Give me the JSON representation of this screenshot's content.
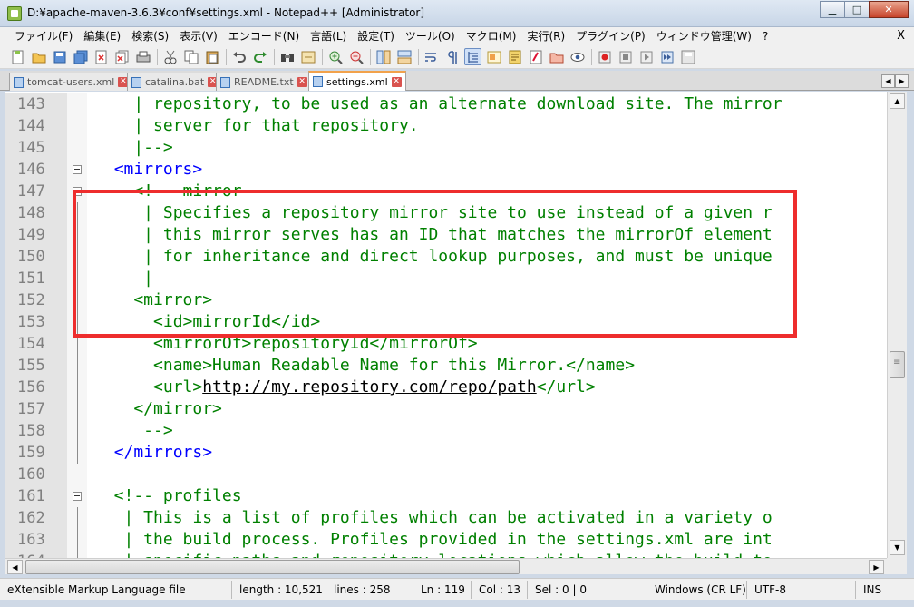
{
  "window": {
    "title": "D:¥apache-maven-3.6.3¥conf¥settings.xml - Notepad++ [Administrator]",
    "minimize": "▁",
    "maximize": "□",
    "close": "✕"
  },
  "menu": {
    "items": [
      "ファイル(F)",
      "編集(E)",
      "検索(S)",
      "表示(V)",
      "エンコード(N)",
      "言語(L)",
      "設定(T)",
      "ツール(O)",
      "マクロ(M)",
      "実行(R)",
      "プラグイン(P)",
      "ウィンドウ管理(W)",
      "?"
    ],
    "doc_close": "X"
  },
  "tabs": [
    {
      "label": "tomcat-users.xml",
      "close": "✕"
    },
    {
      "label": "catalina.bat",
      "close": "✕"
    },
    {
      "label": "README.txt",
      "close": "✕"
    },
    {
      "label": "settings.xml",
      "close": "✕"
    }
  ],
  "tab_scroll": {
    "left": "◀",
    "right": "▶"
  },
  "scroll": {
    "up": "▲",
    "down": "▼",
    "left": "◀",
    "right": "▶",
    "grip": "≡"
  },
  "colors": {
    "highlight": "#ee2d2d",
    "tag": "#0000ff",
    "comment": "#008000",
    "active_tab_accent": "#f2a24b"
  },
  "editor": {
    "lines": [
      {
        "n": "143",
        "fold": "none",
        "segments": [
          {
            "t": "    | repository, to be used as an alternate download site. The mirror",
            "c": "com"
          }
        ]
      },
      {
        "n": "144",
        "fold": "none",
        "segments": [
          {
            "t": "    | server for that repository.",
            "c": "com"
          }
        ]
      },
      {
        "n": "145",
        "fold": "none",
        "segments": [
          {
            "t": "    |-->",
            "c": "com"
          }
        ]
      },
      {
        "n": "146",
        "fold": "box",
        "segments": [
          {
            "t": "  ",
            "c": "txt"
          },
          {
            "t": "<mirrors>",
            "c": "tag"
          }
        ]
      },
      {
        "n": "147",
        "fold": "box",
        "segments": [
          {
            "t": "    <!-- mirror",
            "c": "com"
          }
        ]
      },
      {
        "n": "148",
        "fold": "line",
        "segments": [
          {
            "t": "     | Specifies a repository mirror site to use instead of a given r",
            "c": "com"
          }
        ]
      },
      {
        "n": "149",
        "fold": "line",
        "segments": [
          {
            "t": "     | this mirror serves has an ID that matches the mirrorOf element",
            "c": "com"
          }
        ]
      },
      {
        "n": "150",
        "fold": "line",
        "segments": [
          {
            "t": "     | for inheritance and direct lookup purposes, and must be unique",
            "c": "com"
          }
        ]
      },
      {
        "n": "151",
        "fold": "line",
        "segments": [
          {
            "t": "     |",
            "c": "com"
          }
        ]
      },
      {
        "n": "152",
        "fold": "line",
        "segments": [
          {
            "t": "    <mirror>",
            "c": "com"
          }
        ]
      },
      {
        "n": "153",
        "fold": "line",
        "segments": [
          {
            "t": "      <id>mirrorId</id>",
            "c": "com"
          }
        ]
      },
      {
        "n": "154",
        "fold": "line",
        "segments": [
          {
            "t": "      <mirrorOf>repositoryId</mirrorOf>",
            "c": "com"
          }
        ]
      },
      {
        "n": "155",
        "fold": "line",
        "segments": [
          {
            "t": "      <name>Human Readable Name for this Mirror.</name>",
            "c": "com"
          }
        ]
      },
      {
        "n": "156",
        "fold": "line",
        "segments": [
          {
            "t": "      <url>",
            "c": "com"
          },
          {
            "t": "http://my.repository.com/repo/path",
            "c": "url"
          },
          {
            "t": "</url>",
            "c": "com"
          }
        ]
      },
      {
        "n": "157",
        "fold": "line",
        "segments": [
          {
            "t": "    </mirror>",
            "c": "com"
          }
        ]
      },
      {
        "n": "158",
        "fold": "line",
        "segments": [
          {
            "t": "     -->",
            "c": "com"
          }
        ]
      },
      {
        "n": "159",
        "fold": "line",
        "segments": [
          {
            "t": "  ",
            "c": "txt"
          },
          {
            "t": "</mirrors>",
            "c": "tag"
          }
        ]
      },
      {
        "n": "160",
        "fold": "none",
        "segments": [
          {
            "t": "",
            "c": "txt"
          }
        ]
      },
      {
        "n": "161",
        "fold": "box",
        "segments": [
          {
            "t": "  <!-- profiles",
            "c": "com"
          }
        ]
      },
      {
        "n": "162",
        "fold": "line",
        "segments": [
          {
            "t": "   | This is a list of profiles which can be activated in a variety o",
            "c": "com"
          }
        ]
      },
      {
        "n": "163",
        "fold": "line",
        "segments": [
          {
            "t": "   | the build process. Profiles provided in the settings.xml are int",
            "c": "com"
          }
        ]
      },
      {
        "n": "164",
        "fold": "line",
        "segments": [
          {
            "t": "   | specific paths and repository locations which allow the build to",
            "c": "com"
          }
        ]
      }
    ]
  },
  "status": {
    "file_type": "eXtensible Markup Language file",
    "length": "length : 10,521",
    "lines": "lines : 258",
    "ln": "Ln : 119",
    "col": "Col : 13",
    "sel": "Sel : 0 | 0",
    "eol": "Windows (CR LF)",
    "encoding": "UTF-8",
    "mode": "INS"
  }
}
